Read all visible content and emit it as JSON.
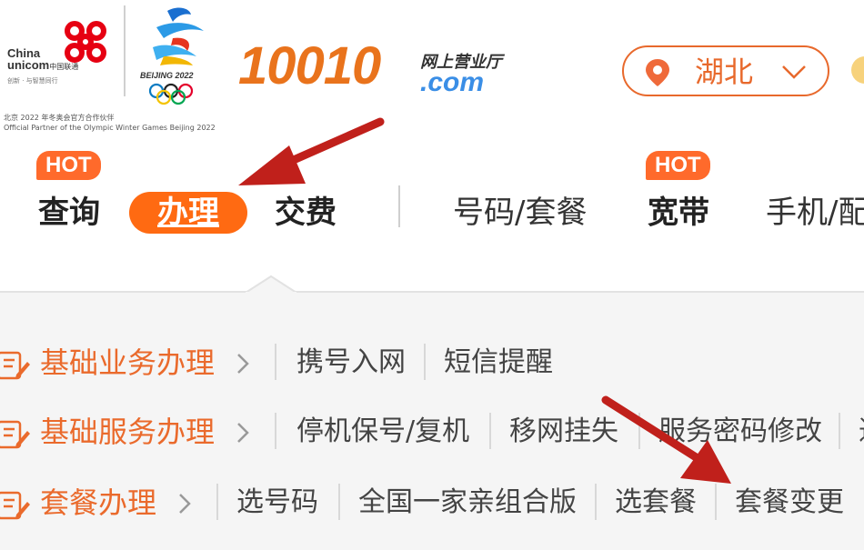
{
  "header": {
    "unicom_en_1": "China",
    "unicom_en_2": "unicom",
    "unicom_cn": "中国联通",
    "unicom_slogan": "创新 · 与智慧同行",
    "olympic_text": "BEIJING 2022",
    "partner_cn": "北京 2022 年冬奥会官方合作伙伴",
    "partner_en": "Official Partner of the Olympic Winter Games Beijing 2022",
    "brand_number": "10010",
    "brand_hall": "网上营业厅",
    "brand_domain": ".com",
    "brand_color": "#e9731c"
  },
  "region": {
    "label": "湖北",
    "icon": "location-pin-icon",
    "color": "#e8692c"
  },
  "nav": {
    "hot_label": "HOT",
    "query": "查询",
    "handle": "办理",
    "pay": "交费",
    "number_plan": "号码/套餐",
    "broadband": "宽带",
    "phone": "手机/配"
  },
  "menu": {
    "rows": [
      {
        "title": "基础业务办理",
        "links": [
          "携号入网",
          "短信提醒"
        ]
      },
      {
        "title": "基础服务办理",
        "links": [
          "停机保号/复机",
          "移网挂失",
          "服务密码修改",
          "迁"
        ]
      },
      {
        "title": "套餐办理",
        "links": [
          "选号码",
          "全国一家亲组合版",
          "选套餐",
          "套餐变更"
        ]
      }
    ]
  },
  "colors": {
    "accent": "#ff6a12",
    "hot": "#ff6a2b",
    "annotation": "#c0201b"
  }
}
